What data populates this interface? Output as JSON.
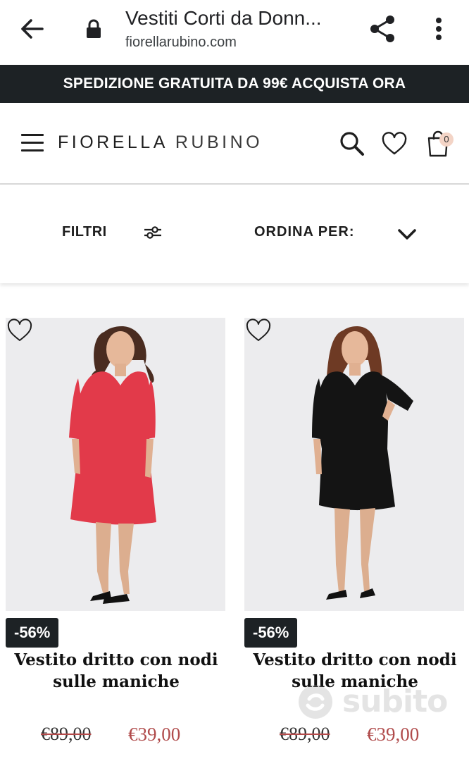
{
  "browser": {
    "title": "Vestiti Corti da Donn...",
    "url": "fiorellarubino.com",
    "icons": [
      "arrow-left-icon",
      "lock-icon",
      "share-icon",
      "more-vert-icon"
    ]
  },
  "promo": {
    "text": "SPEDIZIONE GRATUITA DA 99€ ACQUISTA ORA"
  },
  "header": {
    "logo_part1": "FIORELLA",
    "logo_part2": "RUBINO",
    "cart_count": "0",
    "icons": [
      "menu-icon",
      "search-icon",
      "heart-icon",
      "bag-icon"
    ]
  },
  "toolbar": {
    "filters_label": "FILTRI",
    "sort_label": "ORDINA PER:"
  },
  "products": [
    {
      "discount": "-56%",
      "name": "Vestito dritto con nodi sulle maniche",
      "old_price": "€89,00",
      "new_price": "€39,00",
      "dress_color": "#e23a4a"
    },
    {
      "discount": "-56%",
      "name": "Vestito dritto con nodi sulle maniche",
      "old_price": "€89,00",
      "new_price": "€39,00",
      "dress_color": "#141414"
    }
  ],
  "watermark": {
    "text": "subito"
  },
  "colors": {
    "banner_bg": "#1d2225",
    "price_red": "#b04b4b",
    "badge_bg": "#1d2225",
    "cart_badge": "#f3d4c6"
  }
}
